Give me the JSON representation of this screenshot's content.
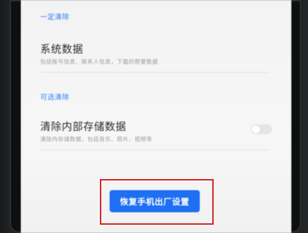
{
  "sections": {
    "required": {
      "label": "一定清除",
      "item": {
        "title": "系统数据",
        "description": "包括账号信息、联系人信息，下载的帮要数据"
      }
    },
    "optional": {
      "label": "可选清除",
      "item": {
        "title": "清除内部存储数据",
        "description": "清除内存储数据，包括音乐、照片、视频等",
        "toggle_on": false
      }
    }
  },
  "reset_button": {
    "label": "恢复手机出厂设置"
  },
  "colors": {
    "accent": "#2f7cf6",
    "button": "#1e6ff2",
    "highlight": "#d42020"
  }
}
